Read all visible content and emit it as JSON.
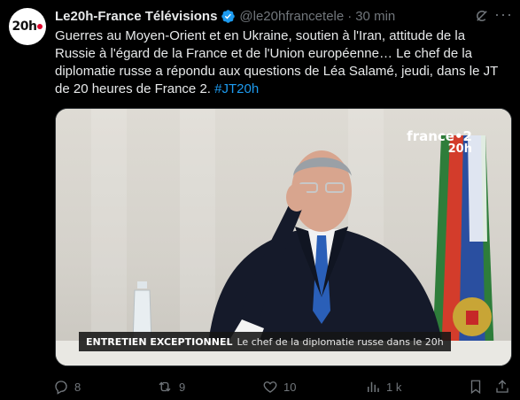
{
  "tweet": {
    "author_name": "Le20h-France Télévisions",
    "handle": "@le20hfrancetele",
    "separator": "·",
    "time": "30 min",
    "avatar_text": "20h",
    "text": "Guerres au Moyen-Orient et en Ukraine, soutien à l'Iran, attitude de la Russie à l'égard de la France et de l'Union européenne… Le chef de la diplomatie russe a répondu aux questions de Léa Salamé, jeudi, dans le JT de 20 heures de France 2. ",
    "hashtag": "#JT20h"
  },
  "media": {
    "watermark_brand": "france•2",
    "watermark_sub": "20h",
    "lower_third_title": "ENTRETIEN EXCEPTIONNEL",
    "lower_third_body": "Le chef de la diplomatie russe dans le 20h"
  },
  "actions": {
    "replies": "8",
    "reposts": "9",
    "likes": "10",
    "views": "1 k"
  },
  "colors": {
    "background": "#000000",
    "text": "#e7e9ea",
    "muted": "#71767b",
    "accent": "#1d9bf0",
    "verified": "#1d9bf0",
    "brand_red": "#e0002a"
  },
  "icons": [
    "verified-badge-icon",
    "grok-icon",
    "more-icon",
    "reply-icon",
    "repost-icon",
    "like-icon",
    "views-icon",
    "bookmark-icon",
    "share-icon"
  ]
}
